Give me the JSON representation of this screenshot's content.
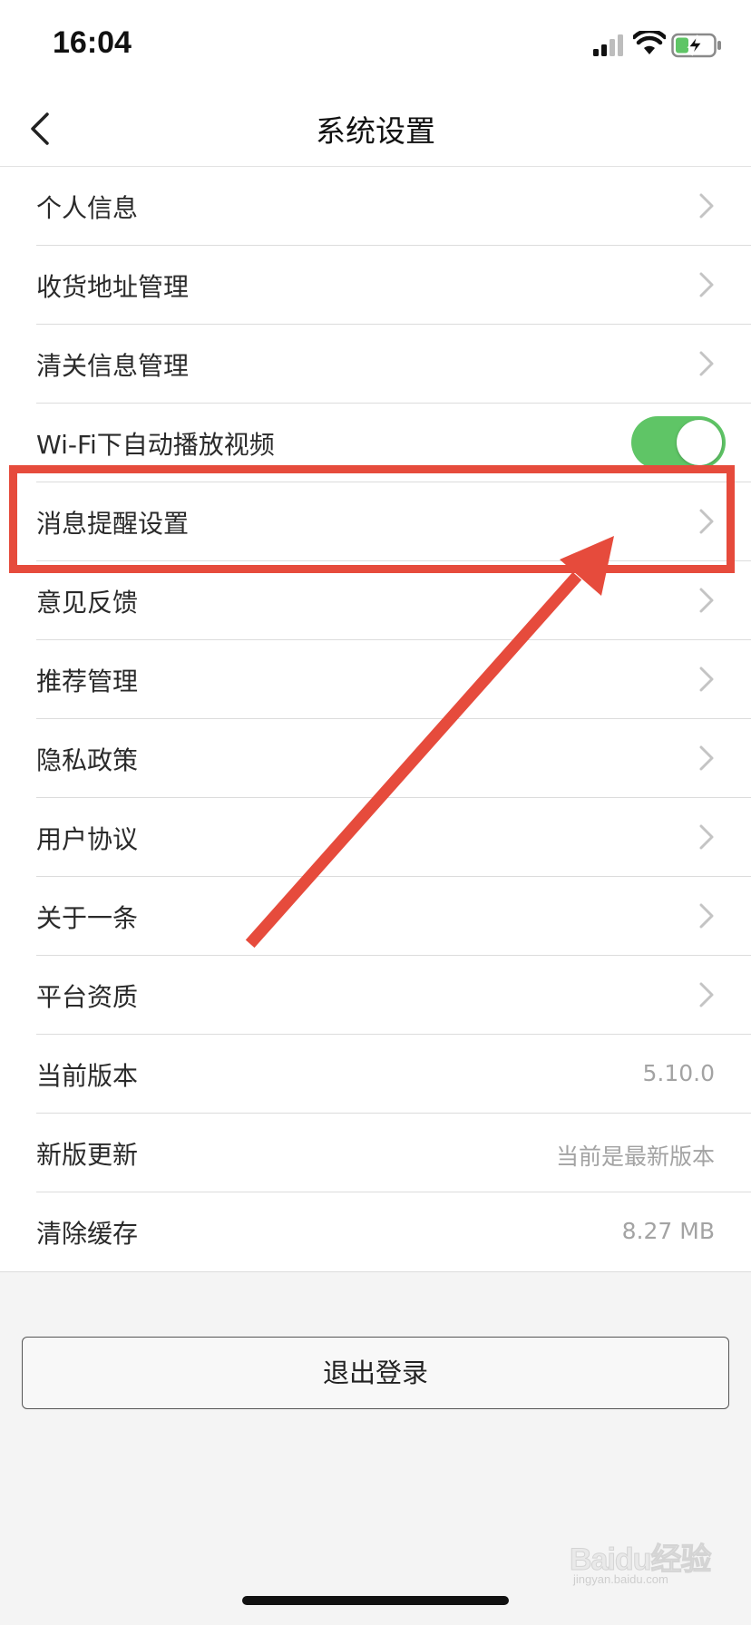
{
  "status_bar": {
    "time": "16:04",
    "icons": [
      "signal-icon",
      "wifi-icon",
      "battery-charging-icon"
    ]
  },
  "nav": {
    "title": "系统设置",
    "back_icon": "chevron-left-icon"
  },
  "settings": {
    "items": [
      {
        "label": "个人信息",
        "accessory": "chevron"
      },
      {
        "label": "收货地址管理",
        "accessory": "chevron"
      },
      {
        "label": "清关信息管理",
        "accessory": "chevron"
      },
      {
        "label": "Wi-Fi下自动播放视频",
        "accessory": "toggle",
        "toggle_on": true
      },
      {
        "label": "消息提醒设置",
        "accessory": "chevron",
        "highlighted": true
      },
      {
        "label": "意见反馈",
        "accessory": "chevron"
      },
      {
        "label": "推荐管理",
        "accessory": "chevron"
      },
      {
        "label": "隐私政策",
        "accessory": "chevron"
      },
      {
        "label": "用户协议",
        "accessory": "chevron"
      },
      {
        "label": "关于一条",
        "accessory": "chevron"
      },
      {
        "label": "平台资质",
        "accessory": "chevron"
      },
      {
        "label": "当前版本",
        "accessory": "value",
        "value": "5.10.0"
      },
      {
        "label": "新版更新",
        "accessory": "value",
        "value": "当前是最新版本"
      },
      {
        "label": "清除缓存",
        "accessory": "value",
        "value": "8.27 MB"
      }
    ]
  },
  "logout": {
    "label": "退出登录"
  },
  "annotation": {
    "highlight_color": "#e64b3c",
    "arrow_color": "#e64b3c"
  },
  "colors": {
    "toggle_on": "#5fc566",
    "chevron": "#c4c4c4",
    "value_text": "#a3a3a3"
  },
  "watermark": {
    "logo": "Baidu经验",
    "sub": "jingyan.baidu.com"
  }
}
